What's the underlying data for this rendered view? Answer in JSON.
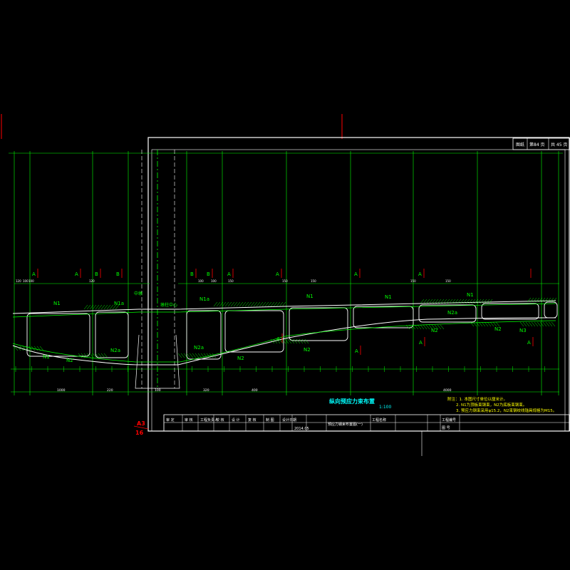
{
  "drawing": {
    "title": "纵向预应力束布置",
    "scale": "1:100",
    "title_block": {
      "cells_row1": [
        "审 定",
        "审 核",
        "工程负责人",
        "校 核",
        "设 计",
        "复 核",
        "制 图",
        "设计日期"
      ],
      "date": "2014.05",
      "drawing_name": "预应力钢束布置图(一)",
      "col_label": "工程名称",
      "project_no": "工程编号",
      "drawing_no_label": "图 号"
    },
    "sheet_box": [
      "图纸",
      "第84 页",
      "共 45 页"
    ],
    "notes": [
      "附注：1. 本图尺寸单位以厘米计。",
      "2. N1为顶板束钢束，N2为底板束钢束。",
      "3. 预应力钢束采用φ15.2，N2束钢绞线锚具规格为M15。"
    ],
    "side_mark": [
      "A3",
      "16"
    ]
  },
  "section_markers": {
    "top_left": [
      "A",
      "A",
      "B",
      "B"
    ],
    "top_right": [
      "B",
      "B",
      "A",
      "A",
      "A",
      "A"
    ],
    "bottom": [
      "A",
      "A",
      "A",
      "A"
    ]
  },
  "tendons": {
    "top": [
      "N1",
      "N1a",
      "N1a",
      "N1",
      "N1",
      "N1"
    ],
    "bottom": [
      "N1",
      "N2",
      "N2a",
      "N2a",
      "N2",
      "N2",
      "N2",
      "N2",
      "N3"
    ],
    "misc": [
      "N2a",
      "中墩",
      "墩柱中心"
    ]
  },
  "dimensions": {
    "bottom_left": [
      "1000",
      "220",
      "100"
    ],
    "bottom_right": [
      "320",
      "400",
      "4000"
    ],
    "top_small": [
      "120",
      "100",
      "100",
      "120",
      "100",
      "100",
      "150",
      "150",
      "150",
      "150",
      "150"
    ]
  },
  "colors": {
    "background": "#000000",
    "frame": "#ffffff",
    "geometry": "#ffffff",
    "annotation": "#00ff00",
    "section_marks": "#ff0000",
    "title": "#00ffff",
    "notes": "#ffff00"
  }
}
